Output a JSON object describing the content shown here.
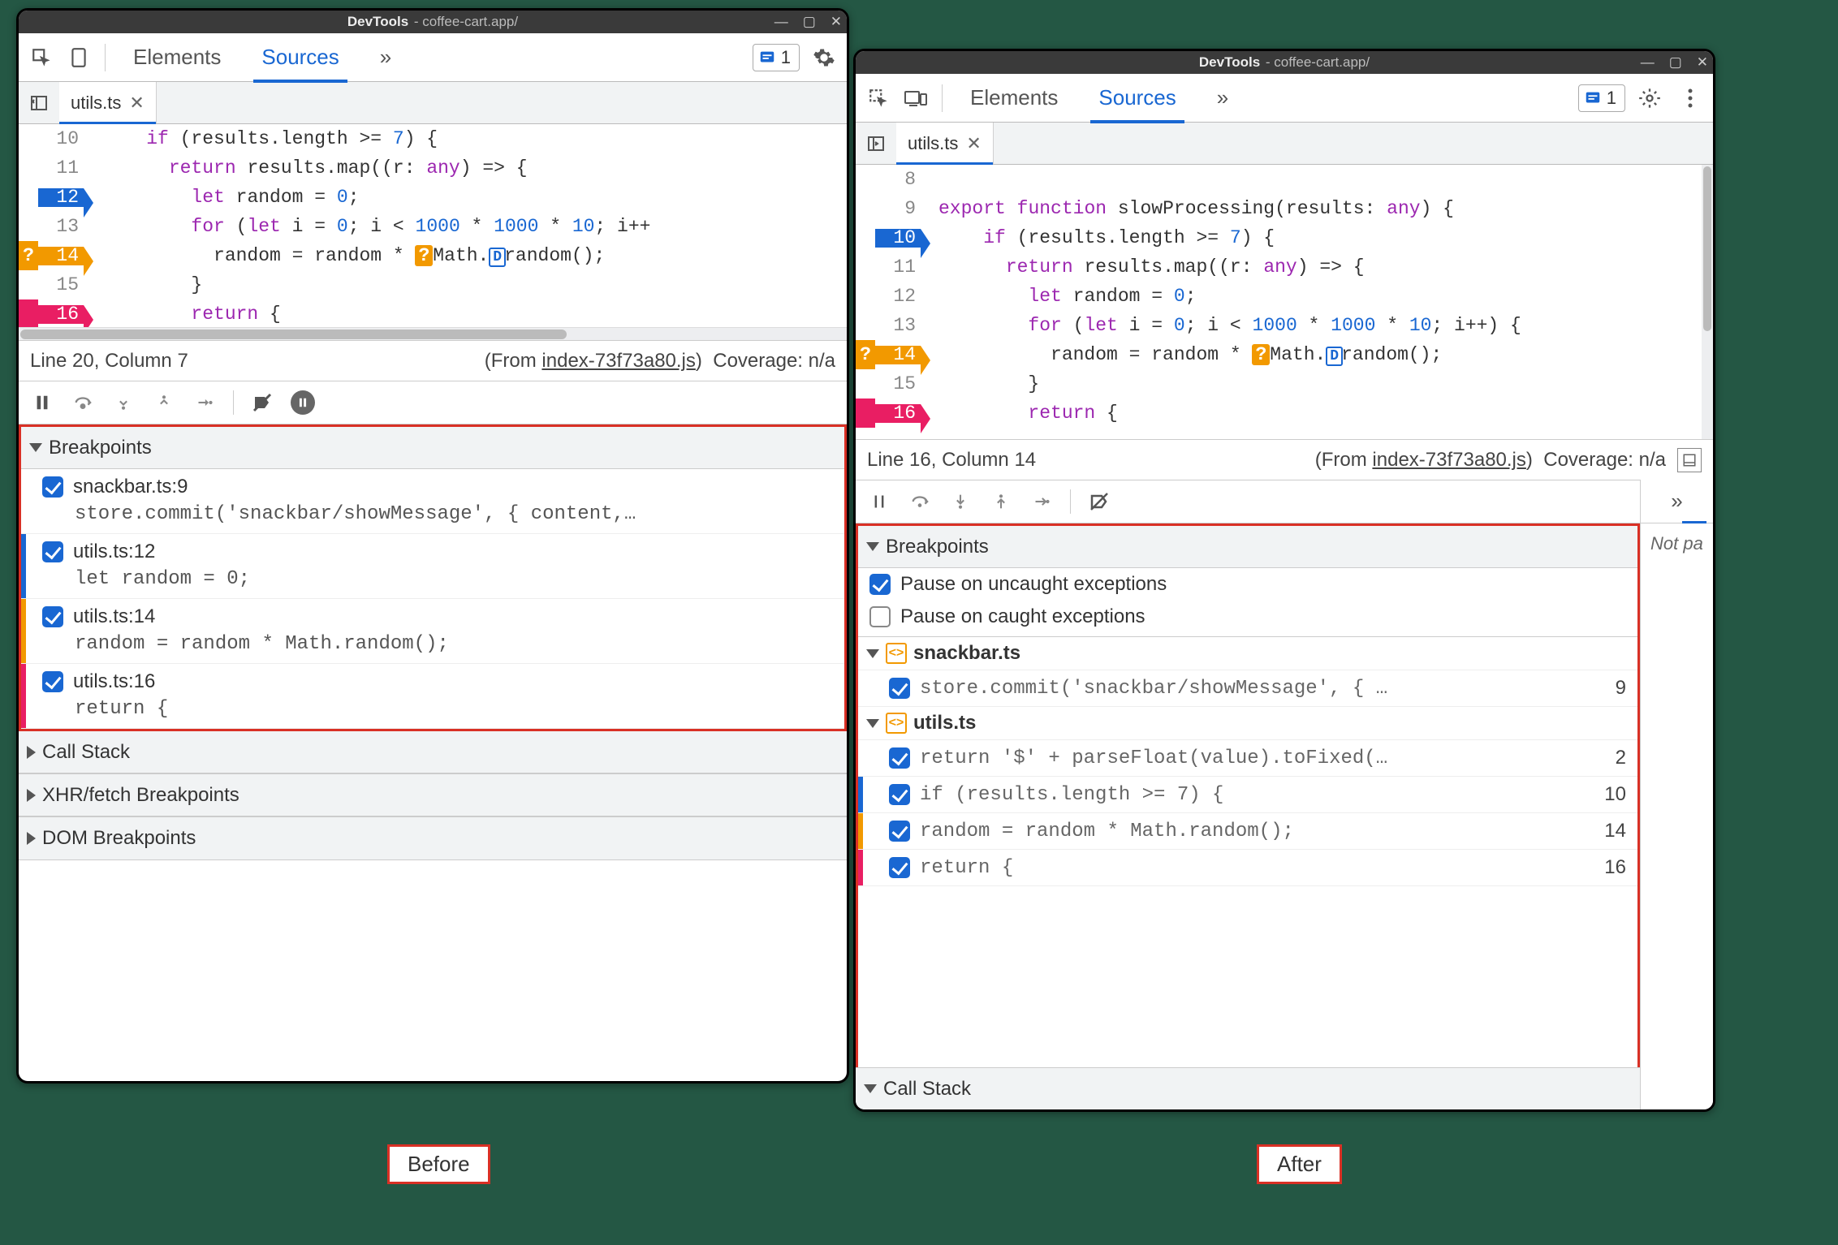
{
  "titlebar": {
    "title": "DevTools",
    "subtitle": "- coffee-cart.app/"
  },
  "panels": {
    "elements": "Elements",
    "sources": "Sources",
    "more": "»"
  },
  "issues_count": "1",
  "file_tab": "utils.ts",
  "code_left": {
    "lines": [
      {
        "n": "10",
        "html": "    <span class='kw'>if</span> (results.length &gt;= <span class='num'>7</span>) {"
      },
      {
        "n": "11",
        "html": "      <span class='kw'>return</span> results.map((<span class='id'>r</span>: <span class='ann'>any</span>) =&gt; {"
      },
      {
        "n": "12",
        "bp": "bp",
        "html": "        <span class='kw'>let</span> random = <span class='num'>0</span>;"
      },
      {
        "n": "13",
        "html": "        <span class='kw'>for</span> (<span class='kw'>let</span> i = <span class='num'>0</span>; i &lt; <span class='num'>1000</span> * <span class='num'>1000</span> * <span class='num'>10</span>; i++"
      },
      {
        "n": "14",
        "bp": "cond",
        "mk": "orange",
        "mktext": "?",
        "html": "          random = random * <span class='badge-q'>?</span>Math.<span class='badge-d'>D</span>random();"
      },
      {
        "n": "15",
        "html": "        }"
      },
      {
        "n": "16",
        "bp": "log",
        "mk": "pink",
        "html": "        <span class='kw'>return</span> {"
      }
    ]
  },
  "code_right": {
    "lines": [
      {
        "n": "8",
        "html": ""
      },
      {
        "n": "9",
        "html": "<span class='kw'>export</span> <span class='kw'>function</span> <span class='fn'>slowProcessing</span>(<span class='id'>results</span>: <span class='ann'>any</span>) {"
      },
      {
        "n": "10",
        "bp": "bp",
        "html": "    <span class='kw'>if</span> (results.length &gt;= <span class='num'>7</span>) {"
      },
      {
        "n": "11",
        "html": "      <span class='kw'>return</span> results.map((<span class='id'>r</span>: <span class='ann'>any</span>) =&gt; {"
      },
      {
        "n": "12",
        "html": "        <span class='kw'>let</span> random = <span class='num'>0</span>;"
      },
      {
        "n": "13",
        "html": "        <span class='kw'>for</span> (<span class='kw'>let</span> i = <span class='num'>0</span>; i &lt; <span class='num'>1000</span> * <span class='num'>1000</span> * <span class='num'>10</span>; i++) {"
      },
      {
        "n": "14",
        "bp": "cond",
        "mk": "orange",
        "mktext": "?",
        "html": "          random = random * <span class='badge-q'>?</span>Math.<span class='badge-d'>D</span>random();"
      },
      {
        "n": "15",
        "html": "        }"
      },
      {
        "n": "16",
        "bp": "log",
        "mk": "pink",
        "html": "        <span class='kw'>return</span> {"
      }
    ]
  },
  "status_left": {
    "pos": "Line 20, Column 7",
    "from": "(From ",
    "link": "index-73f73a80.js",
    "close": ")",
    "cov": "Coverage: n/a"
  },
  "status_right": {
    "pos": "Line 16, Column 14",
    "from": "(From ",
    "link": "index-73f73a80.js",
    "close": ")",
    "cov": "Coverage: n/a"
  },
  "sections": {
    "breakpoints": "Breakpoints",
    "callstack": "Call Stack",
    "xhr": "XHR/fetch Breakpoints",
    "dom": "DOM Breakpoints"
  },
  "bp_left": [
    {
      "stripe": "",
      "title": "snackbar.ts:9",
      "code": "store.commit('snackbar/showMessage', { content,…"
    },
    {
      "stripe": "blue",
      "title": "utils.ts:12",
      "code": "let random = 0;"
    },
    {
      "stripe": "orange",
      "title": "utils.ts:14",
      "code": "random = random * Math.random();"
    },
    {
      "stripe": "pink",
      "title": "utils.ts:16",
      "code": "return {"
    }
  ],
  "bp_right": {
    "opts": {
      "uncaught": "Pause on uncaught exceptions",
      "caught": "Pause on caught exceptions"
    },
    "groups": [
      {
        "name": "snackbar.ts",
        "rows": [
          {
            "stripe": "",
            "code": "store.commit('snackbar/showMessage', { …",
            "n": "9"
          }
        ]
      },
      {
        "name": "utils.ts",
        "rows": [
          {
            "stripe": "",
            "code": "return '$' + parseFloat(value).toFixed(…",
            "n": "2"
          },
          {
            "stripe": "blue",
            "code": "if (results.length >= 7) {",
            "n": "10"
          },
          {
            "stripe": "orange",
            "code": "random = random * Math.random();",
            "n": "14"
          },
          {
            "stripe": "pink",
            "code": "return {",
            "n": "16"
          }
        ]
      }
    ]
  },
  "side_label": "Not pa",
  "labels": {
    "before": "Before",
    "after": "After"
  }
}
